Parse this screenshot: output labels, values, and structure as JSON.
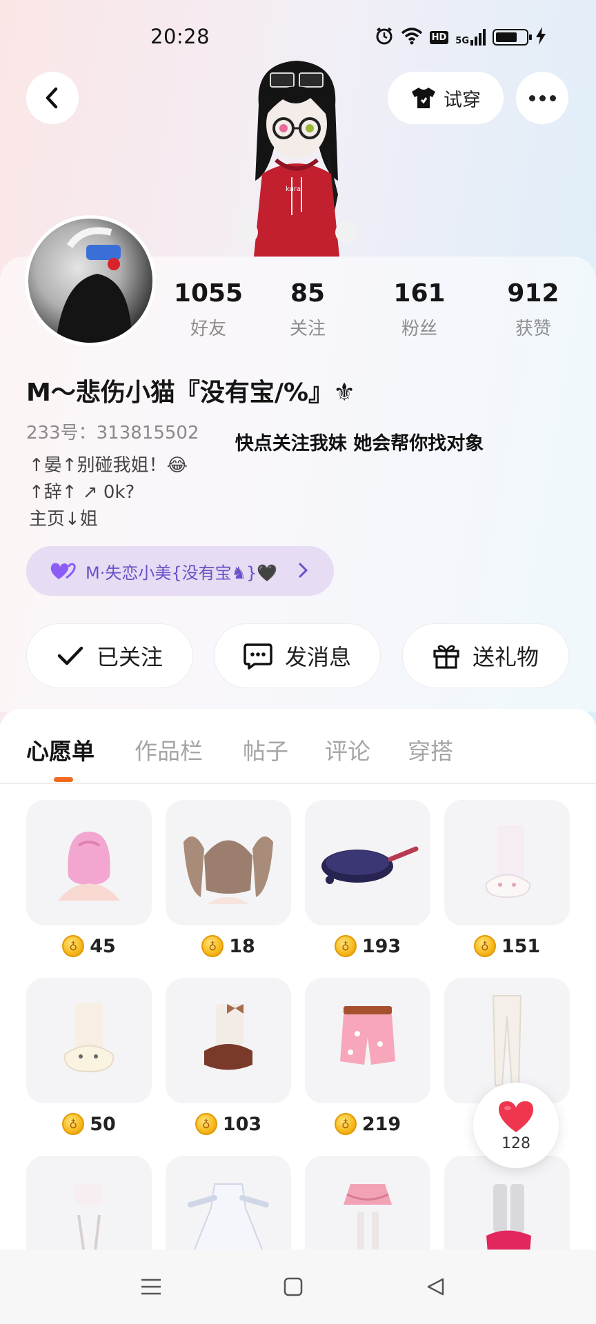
{
  "status_bar": {
    "time": "20:28",
    "hd_label": "HD",
    "network_label": "5G",
    "battery_level": 0.72,
    "icons": [
      "alarm-icon",
      "wifi-icon",
      "hd-icon",
      "5g-signal-icon",
      "battery-icon",
      "charging-icon"
    ]
  },
  "header": {
    "back_icon": "back-arrow-icon",
    "tryon_label": "试穿",
    "tryon_icon": "tshirt-icon",
    "more_icon": "more-dots-icon"
  },
  "profile": {
    "stats": [
      {
        "value": "1055",
        "label": "好友"
      },
      {
        "value": "85",
        "label": "关注"
      },
      {
        "value": "161",
        "label": "粉丝"
      },
      {
        "value": "912",
        "label": "获赞"
      }
    ],
    "nickname": "M～悲伤小猫『没有宝/%』⚜",
    "uid": "233号：313815502",
    "bio": [
      "↑晏↑别碰我姐！😂",
      "↑辞↑  ↗ 0k?",
      "  主页↓姐"
    ],
    "overlay_text": "快点关注我妹  她会帮你找对象",
    "cp_tag": {
      "label": "M·失恋小美{没有宝♞}🖤",
      "heart_color": "#8b5cf6"
    }
  },
  "actions": [
    {
      "label": "已关注",
      "icon": "check-icon"
    },
    {
      "label": "发消息",
      "icon": "message-icon"
    },
    {
      "label": "送礼物",
      "icon": "gift-icon"
    }
  ],
  "tabs": {
    "items": [
      "心愿单",
      "作品栏",
      "帖子",
      "评论",
      "穿搭"
    ],
    "active_index": 0,
    "accent": "#f26b1d"
  },
  "wishlist": {
    "items": [
      {
        "name": "pink-hair-item",
        "price": "45"
      },
      {
        "name": "brown-twintail-hair-item",
        "price": "18"
      },
      {
        "name": "frying-pan-item",
        "price": "193"
      },
      {
        "name": "bunny-socks-item",
        "price": "151"
      },
      {
        "name": "cream-bunny-shoes-item",
        "price": "50"
      },
      {
        "name": "brown-bow-boots-item",
        "price": "103"
      },
      {
        "name": "pink-shorts-item",
        "price": "219"
      },
      {
        "name": "white-stockings-item",
        "price": ""
      },
      {
        "name": "white-lace-outfit-item",
        "price": ""
      },
      {
        "name": "white-dress-item",
        "price": ""
      },
      {
        "name": "pink-frill-skirt-item",
        "price": ""
      },
      {
        "name": "grey-leg-warmers-item",
        "price": ""
      }
    ]
  },
  "like_button": {
    "count": "128",
    "icon": "heart-icon",
    "color": "#f0364f"
  },
  "navigation": {
    "icons": [
      "menu-icon",
      "home-square-icon",
      "back-triangle-icon"
    ]
  }
}
